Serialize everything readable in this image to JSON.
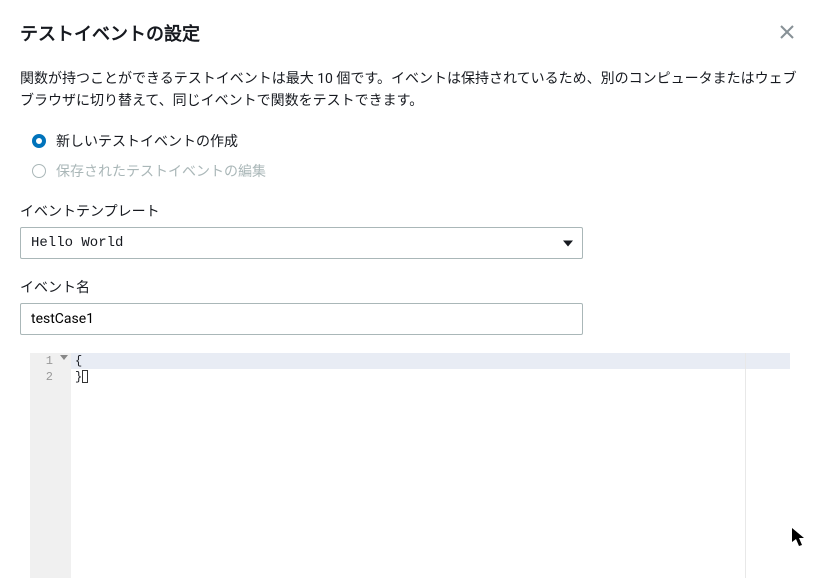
{
  "dialog": {
    "title": "テストイベントの設定",
    "description": "関数が持つことができるテストイベントは最大 10 個です。イベントは保持されているため、別のコンピュータまたはウェブブラウザに切り替えて、同じイベントで関数をテストできます。"
  },
  "radios": {
    "create": "新しいテストイベントの作成",
    "edit": "保存されたテストイベントの編集"
  },
  "templateField": {
    "label": "イベントテンプレート",
    "value": "Hello World"
  },
  "nameField": {
    "label": "イベント名",
    "value": "testCase1"
  },
  "editor": {
    "line1_num": "1",
    "line2_num": "2",
    "line1_code": "{",
    "line2_code": "}"
  }
}
